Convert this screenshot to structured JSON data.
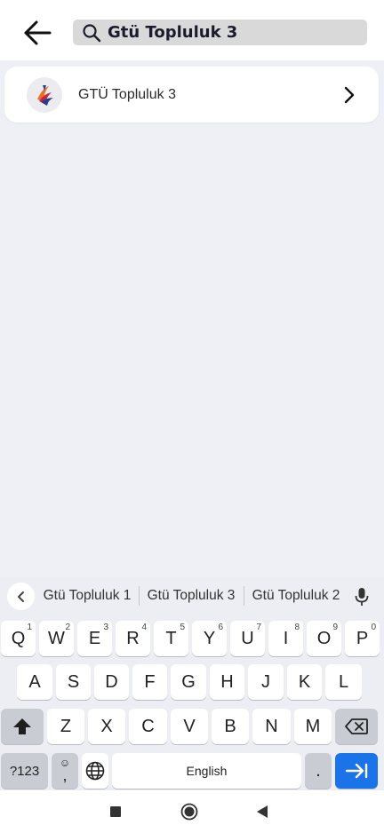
{
  "header": {
    "search_value": "Gtü Topluluk 3"
  },
  "results": [
    {
      "title": "GTÜ Topluluk 3"
    }
  ],
  "keyboard": {
    "suggestions": [
      "Gtü Topluluk 1",
      "Gtü Topluluk 3",
      "Gtü Topluluk 2"
    ],
    "row1": [
      {
        "k": "Q",
        "h": "1"
      },
      {
        "k": "W",
        "h": "2"
      },
      {
        "k": "E",
        "h": "3"
      },
      {
        "k": "R",
        "h": "4"
      },
      {
        "k": "T",
        "h": "5"
      },
      {
        "k": "Y",
        "h": "6"
      },
      {
        "k": "U",
        "h": "7"
      },
      {
        "k": "I",
        "h": "8"
      },
      {
        "k": "O",
        "h": "9"
      },
      {
        "k": "P",
        "h": "0"
      }
    ],
    "row2": [
      "A",
      "S",
      "D",
      "F",
      "G",
      "H",
      "J",
      "K",
      "L"
    ],
    "row3": [
      "Z",
      "X",
      "C",
      "V",
      "B",
      "N",
      "M"
    ],
    "symbols_label": "?123",
    "emoji_comma": ",",
    "space_label": "English",
    "period_label": "."
  },
  "colors": {
    "accent": "#1a73e8",
    "search_bg": "#d9d9d9",
    "page_bg": "#eef0f5"
  },
  "icons": {
    "back": "arrow-left-icon",
    "search": "search-icon",
    "chevron": "chevron-right-icon",
    "mic": "mic-icon",
    "globe": "globe-icon",
    "shift": "shift-icon",
    "backspace": "backspace-icon",
    "enter": "tab-arrow-icon"
  }
}
